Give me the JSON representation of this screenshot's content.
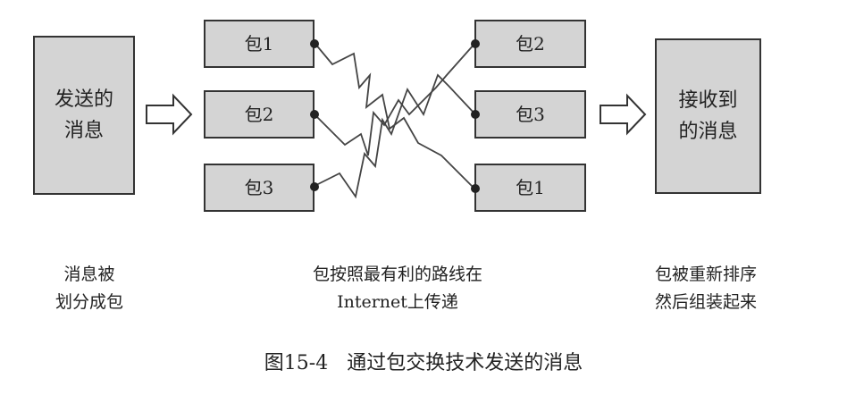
{
  "source_box": {
    "line1": "发送的",
    "line2": "消息"
  },
  "dest_box": {
    "line1": "接收到",
    "line2": "的消息"
  },
  "left_packets": [
    "包1",
    "包2",
    "包3"
  ],
  "right_packets": [
    "包2",
    "包3",
    "包1"
  ],
  "captions": {
    "left": {
      "line1": "消息被",
      "line2": "划分成包"
    },
    "middle": {
      "line1": "包按照最有利的路线在",
      "line2": "Internet上传递"
    },
    "right": {
      "line1": "包被重新排序",
      "line2": "然后组装起来"
    }
  },
  "figure": {
    "number": "图15-4",
    "title": "通过包交换技术发送的消息"
  }
}
